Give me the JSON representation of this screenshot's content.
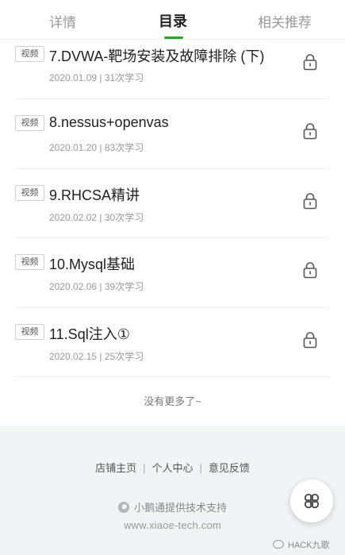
{
  "tabs": [
    {
      "label": "详情"
    },
    {
      "label": "目录"
    },
    {
      "label": "相关推荐"
    }
  ],
  "accent_color": "#1aad19",
  "lessons": [
    {
      "badge": "视频",
      "title": "7.DVWA-靶场安装及故障排除 (下)",
      "meta": "2020.01.09 | 31次学习",
      "icon": "lock-icon"
    },
    {
      "badge": "视频",
      "title": "8.nessus+openvas",
      "meta": "2020.01.20 | 83次学习",
      "icon": "lock-icon"
    },
    {
      "badge": "视频",
      "title": "9.RHCSA精讲",
      "meta": "2020.02.02 | 30次学习",
      "icon": "lock-icon"
    },
    {
      "badge": "视频",
      "title": "10.Mysql基础",
      "meta": "2020.02.06 | 39次学习",
      "icon": "lock-icon"
    },
    {
      "badge": "视频",
      "title": "11.Sql注入①",
      "meta": "2020.02.15 | 25次学习",
      "icon": "lock-icon"
    }
  ],
  "no_more_text": "没有更多了~",
  "footer": {
    "links": [
      "店铺主页",
      "个人中心",
      "意见反馈"
    ],
    "powered_by": "小鹅通提供技术支持",
    "domain": "www.xiaoe-tech.com",
    "watermark": "HACK九歌"
  },
  "fab": {
    "icon": "clover-menu-icon"
  }
}
